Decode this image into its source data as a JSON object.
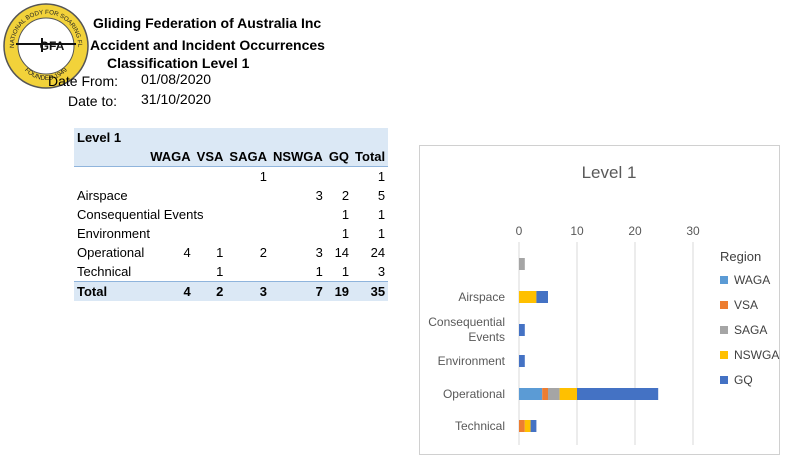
{
  "header": {
    "title_line1": "Gliding Federation of Australia Inc",
    "title_line2": "Accident and Incident Occurrences",
    "title_line3": "Classification Level 1",
    "date_from_label": "Date From:",
    "date_from_value": "01/08/2020",
    "date_to_label": "Date to:",
    "date_to_value": "31/10/2020"
  },
  "logo": {
    "text_top": "THE NATIONAL BODY FOR SOARING FLIGHT",
    "text_center": "GFA",
    "text_bottom": "FOUNDED 1949"
  },
  "pivot_table": {
    "title": "Level 1",
    "columns": [
      "WAGA",
      "VSA",
      "SAGA",
      "NSWGA",
      "GQ",
      "Total"
    ],
    "rows": [
      {
        "label": "",
        "values": [
          "",
          "",
          "1",
          "",
          "",
          "1"
        ]
      },
      {
        "label": "Airspace",
        "values": [
          "",
          "",
          "",
          "3",
          "2",
          "5"
        ]
      },
      {
        "label": "Consequential Events",
        "values": [
          "",
          "",
          "",
          "",
          "1",
          "1"
        ]
      },
      {
        "label": "Environment",
        "values": [
          "",
          "",
          "",
          "",
          "1",
          "1"
        ]
      },
      {
        "label": "Operational",
        "values": [
          "4",
          "1",
          "2",
          "3",
          "14",
          "24"
        ]
      },
      {
        "label": "Technical",
        "values": [
          "",
          "1",
          "",
          "1",
          "1",
          "3"
        ]
      }
    ],
    "total": {
      "label": "Total",
      "values": [
        "4",
        "2",
        "3",
        "7",
        "19",
        "35"
      ]
    }
  },
  "chart_data": {
    "type": "bar",
    "orientation": "horizontal",
    "stacked": true,
    "title": "Level 1",
    "legend_title": "Region",
    "legend_position": "right",
    "categories": [
      "",
      "Airspace",
      "Consequential Events",
      "Environment",
      "Operational",
      "Technical"
    ],
    "series": [
      {
        "name": "WAGA",
        "color": "#5b9bd5",
        "values": [
          0,
          0,
          0,
          0,
          4,
          0
        ]
      },
      {
        "name": "VSA",
        "color": "#ed7d31",
        "values": [
          0,
          0,
          0,
          0,
          1,
          1
        ]
      },
      {
        "name": "SAGA",
        "color": "#a5a5a5",
        "values": [
          1,
          0,
          0,
          0,
          2,
          0
        ]
      },
      {
        "name": "NSWGA",
        "color": "#ffc000",
        "values": [
          0,
          3,
          0,
          0,
          3,
          1
        ]
      },
      {
        "name": "GQ",
        "color": "#4472c4",
        "values": [
          0,
          2,
          1,
          1,
          14,
          1
        ]
      }
    ],
    "xlim": [
      0,
      30
    ],
    "xticks": [
      "0",
      "10",
      "20",
      "30"
    ],
    "grid": true
  }
}
